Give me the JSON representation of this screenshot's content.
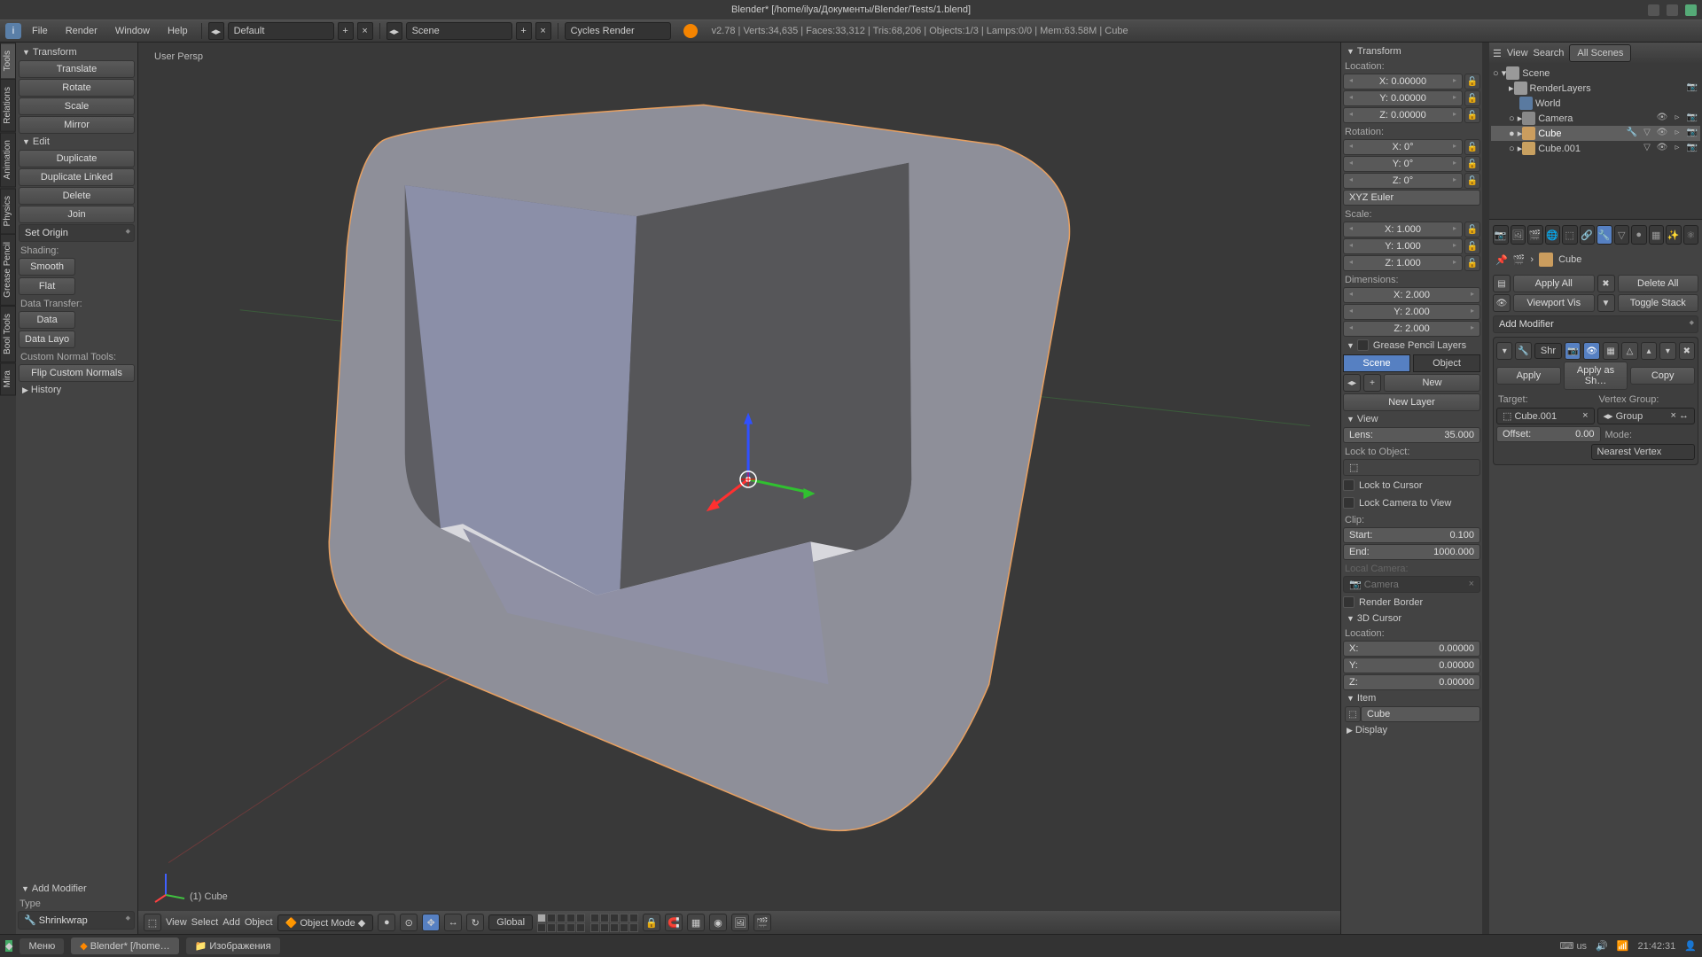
{
  "title": "Blender* [/home/ilya/Документы/Blender/Tests/1.blend]",
  "menu": {
    "file": "File",
    "render": "Render",
    "window": "Window",
    "help": "Help"
  },
  "layout_dd": "Default",
  "scene_dd": "Scene",
  "engine_dd": "Cycles Render",
  "stats": "v2.78 | Verts:34,635 | Faces:33,312 | Tris:68,206 | Objects:1/3 | Lamps:0/0 | Mem:63.58M | Cube",
  "vtabs": [
    "Tools",
    "Relations",
    "Animation",
    "Physics",
    "Grease Pencil",
    "Bool Tools",
    "Mira"
  ],
  "tool": {
    "transform_hdr": "Transform",
    "translate": "Translate",
    "rotate": "Rotate",
    "scale": "Scale",
    "mirror": "Mirror",
    "edit_hdr": "Edit",
    "duplicate": "Duplicate",
    "duplicate_linked": "Duplicate Linked",
    "delete": "Delete",
    "join": "Join",
    "set_origin": "Set Origin",
    "shading": "Shading:",
    "smooth": "Smooth",
    "flat": "Flat",
    "data_transfer": "Data Transfer:",
    "data": "Data",
    "data_layo": "Data Layo",
    "custom_normal": "Custom Normal Tools:",
    "flip_normals": "Flip Custom Normals",
    "history": "History",
    "add_modifier_hdr": "Add Modifier",
    "type": "Type",
    "modifier": "Shrinkwrap"
  },
  "vp": {
    "persp": "User Persp",
    "objname": "(1) Cube"
  },
  "vpfooter": {
    "view": "View",
    "select": "Select",
    "add": "Add",
    "object": "Object",
    "mode": "Object Mode",
    "orient": "Global"
  },
  "np": {
    "transform": "Transform",
    "location": "Location:",
    "rotation": "Rotation:",
    "scale": "Scale:",
    "dimensions": "Dimensions:",
    "x": "X:",
    "y": "Y:",
    "z": "Z:",
    "loc_x": "0.00000",
    "loc_y": "0.00000",
    "loc_z": "0.00000",
    "rot_x": "0°",
    "rot_y": "0°",
    "rot_z": "0°",
    "rot_mode": "XYZ Euler",
    "sc_x": "1.000",
    "sc_y": "1.000",
    "sc_z": "1.000",
    "dim_x": "2.000",
    "dim_y": "2.000",
    "dim_z": "2.000",
    "gp_hdr": "Grease Pencil Layers",
    "scene": "Scene",
    "object": "Object",
    "new": "New",
    "newlayer": "New Layer",
    "view_hdr": "View",
    "lens": "Lens:",
    "lens_v": "35.000",
    "locktoobj": "Lock to Object:",
    "locktocursor": "Lock to Cursor",
    "lockcam": "Lock Camera to View",
    "clip": "Clip:",
    "start": "Start:",
    "start_v": "0.100",
    "end": "End:",
    "end_v": "1000.000",
    "localcam": "Local Camera:",
    "camera": "Camera",
    "renderborder": "Render Border",
    "cursor_hdr": "3D Cursor",
    "c_x": "0.00000",
    "c_y": "0.00000",
    "c_z": "0.00000",
    "item_hdr": "Item",
    "item_name": "Cube",
    "display": "Display"
  },
  "out": {
    "view": "View",
    "search": "Search",
    "allscenes": "All Scenes",
    "scene": "Scene",
    "renderlayers": "RenderLayers",
    "world": "World",
    "camera": "Camera",
    "cube": "Cube",
    "cube001": "Cube.001"
  },
  "props": {
    "obj": "Cube",
    "apply_all": "Apply All",
    "delete_all": "Delete All",
    "viewport_vis": "Viewport Vis",
    "toggle_stack": "Toggle Stack",
    "add_modifier": "Add Modifier",
    "shr": "Shr",
    "apply": "Apply",
    "apply_shape": "Apply as Sh…",
    "copy": "Copy",
    "target": "Target:",
    "target_v": "Cube.001",
    "vgroup": "Vertex Group:",
    "group": "Group",
    "offset": "Offset:",
    "offset_v": "0.00",
    "mode": "Mode:",
    "mode_v": "Nearest Vertex"
  },
  "taskbar": {
    "menu": "Меню",
    "blender": "Blender* [/home…",
    "images": "Изображения",
    "lang": "us",
    "time": "21:42:31"
  }
}
